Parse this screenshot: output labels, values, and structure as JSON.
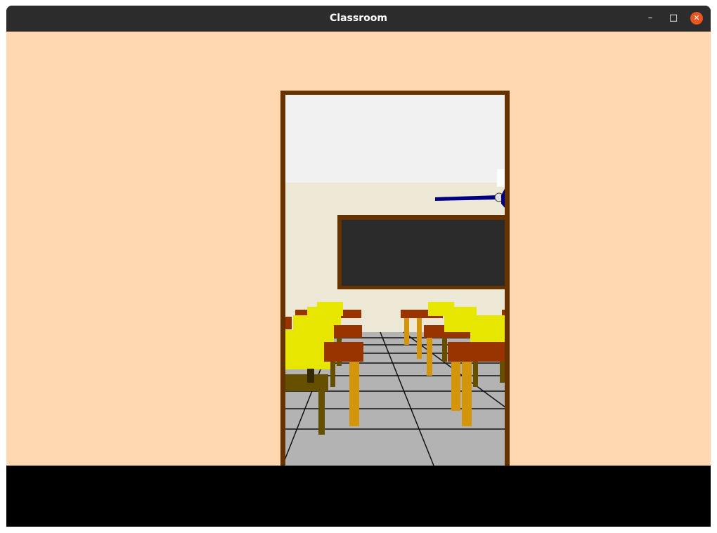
{
  "window": {
    "title": "Classroom",
    "controls": {
      "minimize_icon": "minimize-icon",
      "maximize_icon": "maximize-icon",
      "close_icon": "close-icon",
      "close_color": "#e95420"
    }
  },
  "scene": {
    "wall_color": "#ffd8b1",
    "door_frame_color": "#663300",
    "ceiling_color": "#f2f1f1",
    "interior_wall_color": "#ede8d5",
    "floor_color": "#b3b3b3",
    "blackboard_color": "#2a2a2a",
    "desk_color": "#993300",
    "chair_color": "#e6e600",
    "leg_color": "#d4950a",
    "fan_color": "#000080"
  }
}
